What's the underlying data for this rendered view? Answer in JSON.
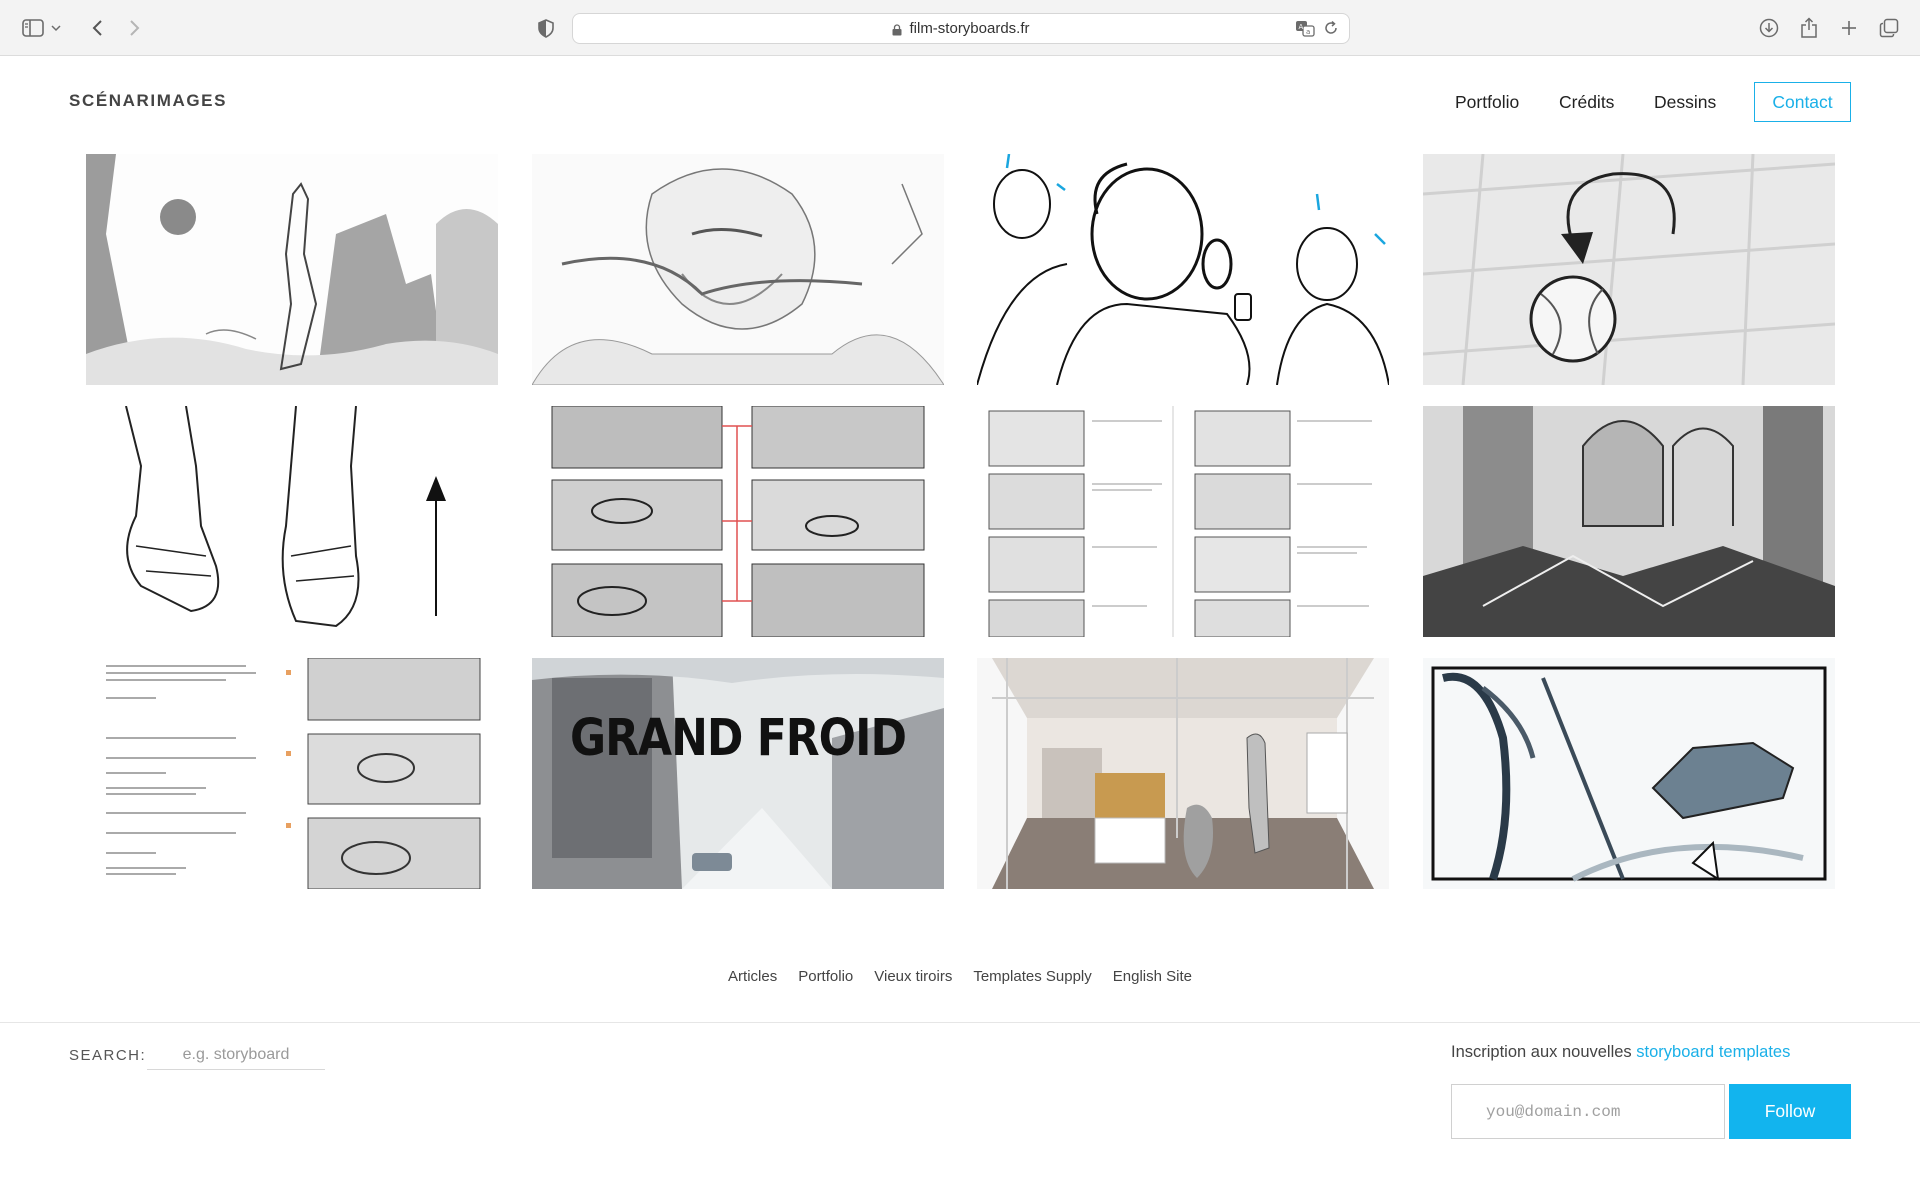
{
  "browser": {
    "url": "film-storyboards.fr",
    "icons": [
      "sidebar-icon",
      "chevron-down-icon",
      "back-icon",
      "forward-icon",
      "shield-icon",
      "lock-icon",
      "translate-icon",
      "reload-icon",
      "download-icon",
      "share-icon",
      "new-tab-icon",
      "tabs-overview-icon"
    ]
  },
  "site": {
    "logo": "SCÉNARIMAGES",
    "accent": "#1ab0e8"
  },
  "nav": {
    "portfolio": "Portfolio",
    "credits": "Crédits",
    "dessins": "Dessins",
    "contact": "Contact"
  },
  "gallery": {
    "grand_froid_title": "GRAND FROID"
  },
  "footer": {
    "links": [
      "Articles",
      "Portfolio",
      "Vieux tiroirs",
      "Templates Supply",
      "English Site"
    ],
    "search_label": "SEARCH:",
    "search_placeholder": "e.g. storyboard",
    "newsletter_text": "Inscription aux nouvelles ",
    "newsletter_link": "storyboard templates",
    "email_placeholder": "you@domain.com",
    "follow_label": "Follow",
    "button_color": "#12b4ee"
  }
}
